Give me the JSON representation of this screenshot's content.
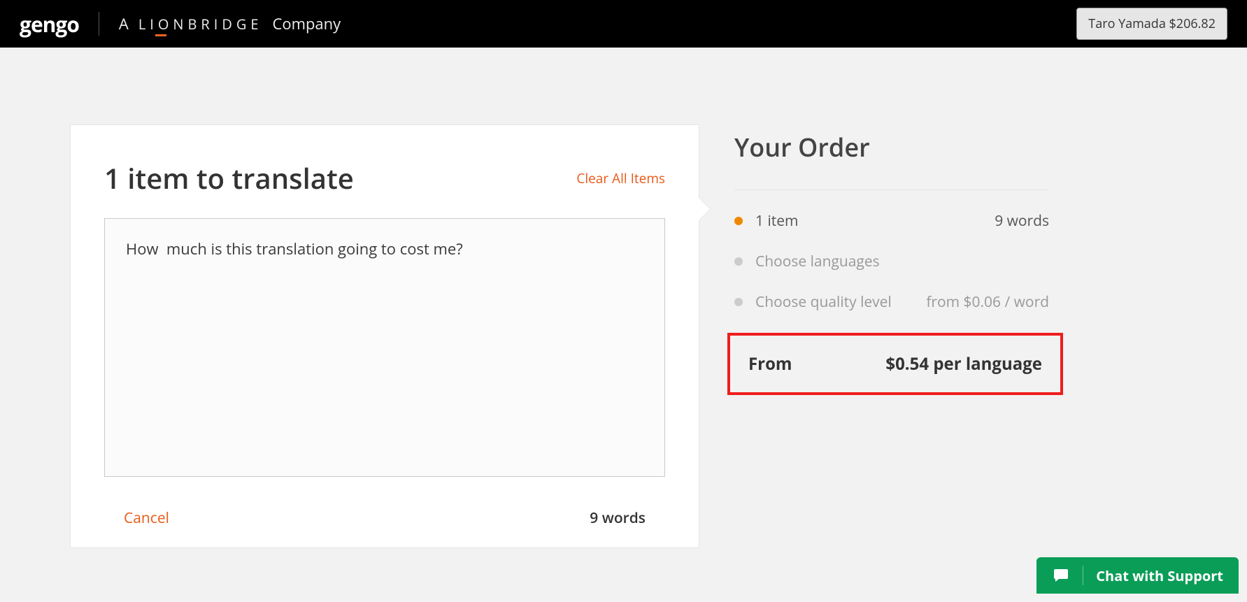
{
  "header": {
    "gengo_logo": "gengo",
    "lionbridge_prefix": "A",
    "lionbridge_word": "LIONBRIDGE",
    "lionbridge_suffix": "Company",
    "user_name": "Taro Yamada",
    "user_balance": "$206.82"
  },
  "card": {
    "title": "1 item to translate",
    "clear_label": "Clear All Items",
    "textarea_value": "How  much is this translation going to cost me?",
    "cancel_label": "Cancel",
    "word_count": "9 words"
  },
  "order": {
    "title": "Your Order",
    "steps": [
      {
        "label": "1 item",
        "right": "9 words",
        "active": true
      },
      {
        "label": "Choose languages",
        "right": "",
        "active": false
      },
      {
        "label": "Choose quality level",
        "right": "from $0.06 / word",
        "active": false
      }
    ],
    "total_from_label": "From",
    "total_price": "$0.54 per language"
  },
  "chat": {
    "label": "Chat with Support"
  }
}
